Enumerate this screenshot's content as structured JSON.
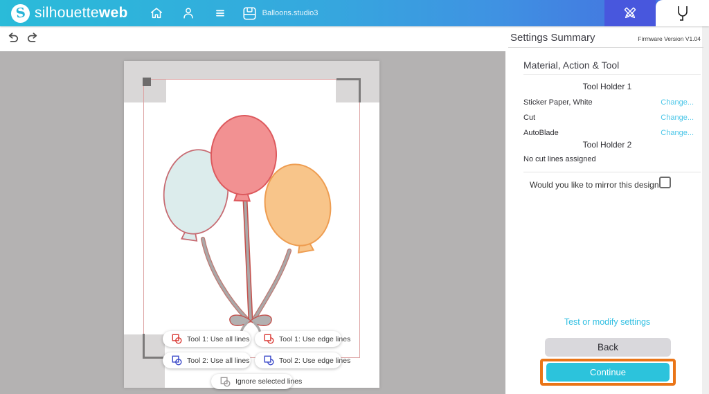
{
  "topbar": {
    "brand_regular": "silhouette",
    "brand_bold": "web",
    "file_name": "Balloons.studio3",
    "icons": [
      "silhouette-logo",
      "home",
      "account",
      "menu",
      "save-file",
      "design-tools",
      "send-blade"
    ]
  },
  "toolbar": {
    "icons": [
      "undo",
      "redo"
    ]
  },
  "canvas": {
    "tool_buttons": [
      {
        "label": "Tool 1: Use all lines"
      },
      {
        "label": "Tool 1: Use edge lines"
      },
      {
        "label": "Tool 2: Use all lines"
      },
      {
        "label": "Tool 2: Use edge lines"
      },
      {
        "label": "Ignore selected lines"
      }
    ],
    "artwork": "three balloons (light blue, red, orange) tied with strings to a bow"
  },
  "panel": {
    "title": "Settings Summary",
    "firmware": "Firmware Version V1.04",
    "section_title": "Material, Action & Tool",
    "tool_holder_1_title": "Tool Holder 1",
    "rows": [
      {
        "label": "Sticker Paper, White",
        "action": "Change..."
      },
      {
        "label": "Cut",
        "action": "Change..."
      },
      {
        "label": "AutoBlade",
        "action": "Change..."
      }
    ],
    "tool_holder_2_title": "Tool Holder 2",
    "tool_holder_2_status": "No cut lines assigned",
    "mirror_question": "Would you like to mirror this design?",
    "mirror_checked": false,
    "test_link": "Test or modify settings",
    "back_label": "Back",
    "continue_label": "Continue"
  },
  "colors": {
    "topbar_gradient_start": "#2abbd9",
    "topbar_gradient_end": "#4766df",
    "active_tab_blue": "#4857dd",
    "link_cyan": "#4ac6e8",
    "continue_cyan": "#2cc3dc",
    "highlight_orange": "#ea7517",
    "tool1_red": "#d93a35",
    "tool2_blue": "#3847c8",
    "balloon_blue": "#dcecec",
    "balloon_red": "#f29192",
    "balloon_orange": "#f8c58a"
  }
}
